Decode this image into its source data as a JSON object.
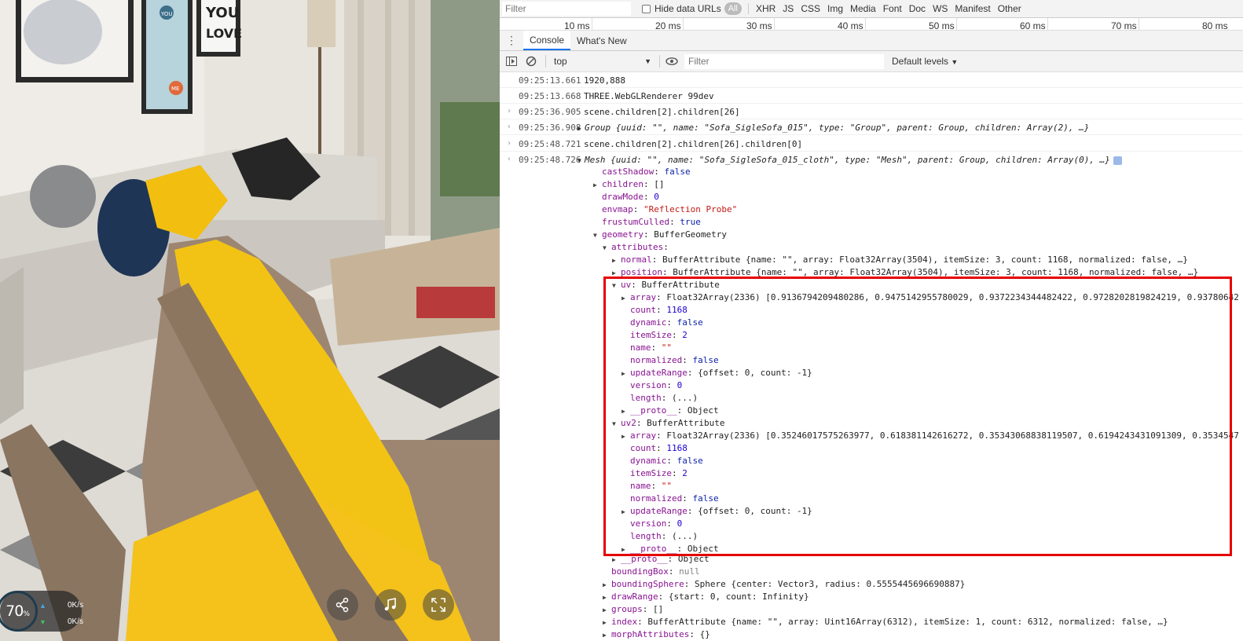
{
  "overlay": {
    "percent": "70",
    "percent_unit": "%",
    "upload_rate": "0K/s",
    "download_rate": "0K/s"
  },
  "scene_art": {
    "poster_you": "YOU",
    "poster_love": "LOVE",
    "fish_tags": [
      "YOU",
      "ME"
    ]
  },
  "network_bar": {
    "filter_placeholder": "Filter",
    "hide_data_urls": "Hide data URLs",
    "all": "All",
    "types": [
      "XHR",
      "JS",
      "CSS",
      "Img",
      "Media",
      "Font",
      "Doc",
      "WS",
      "Manifest",
      "Other"
    ],
    "ticks": [
      "10 ms",
      "20 ms",
      "30 ms",
      "40 ms",
      "50 ms",
      "60 ms",
      "70 ms",
      "80 ms"
    ]
  },
  "drawer": {
    "tabs": [
      "Console",
      "What's New"
    ]
  },
  "console_toolbar": {
    "context": "top",
    "filter_placeholder": "Filter",
    "levels": "Default levels"
  },
  "messages": [
    {
      "ts": "09:25:13.661",
      "text": "1920,888"
    },
    {
      "ts": "09:25:13.668",
      "text": "THREE.WebGLRenderer 99dev"
    },
    {
      "ts": "09:25:36.905",
      "text": "scene.children[2].children[26]"
    },
    {
      "ts": "09:25:36.908",
      "text": "Group {uuid: \"\", name: \"Sofa_SigleSofa_015\", type: \"Group\", parent: Group, children: Array(2), …}"
    },
    {
      "ts": "09:25:48.721",
      "text": "scene.children[2].children[26].children[0]"
    },
    {
      "ts": "09:25:48.726",
      "text": "Mesh {uuid: \"\", name: \"Sofa_SigleSofa_015_cloth\", type: \"Mesh\", parent: Group, children: Array(0), …}"
    }
  ],
  "tree": [
    {
      "key": "castShadow",
      "sep": ": ",
      "val": "false"
    },
    {
      "key": "children",
      "sep": ": ",
      "val": "[]"
    },
    {
      "key": "drawMode",
      "sep": ": ",
      "val": "0"
    },
    {
      "key": "envmap",
      "sep": ": ",
      "val": "\"Reflection Probe\""
    },
    {
      "key": "frustumCulled",
      "sep": ": ",
      "val": "true"
    },
    {
      "key": "geometry",
      "sep": ": ",
      "val": "BufferGeometry"
    },
    {
      "key": "attributes",
      "sep": ":",
      "val": ""
    },
    {
      "key": "normal",
      "sep": ": ",
      "val": "BufferAttribute {name: \"\", array: Float32Array(3504), itemSize: 3, count: 1168, normalized: false, …}"
    },
    {
      "key": "position",
      "sep": ": ",
      "val": "BufferAttribute {name: \"\", array: Float32Array(3504), itemSize: 3, count: 1168, normalized: false, …}"
    },
    {
      "key": "uv",
      "sep": ": ",
      "val": "BufferAttribute"
    },
    {
      "key": "array",
      "sep": ": ",
      "val": "Float32Array(2336) [0.9136794209480286, 0.9475142955780029, 0.9372234344482422, 0.9728202819824219, 0.93780642"
    },
    {
      "key": "count",
      "sep": ": ",
      "val": "1168"
    },
    {
      "key": "dynamic",
      "sep": ": ",
      "val": "false"
    },
    {
      "key": "itemSize",
      "sep": ": ",
      "val": "2"
    },
    {
      "key": "name",
      "sep": ": ",
      "val": "\"\""
    },
    {
      "key": "normalized",
      "sep": ": ",
      "val": "false"
    },
    {
      "key": "updateRange",
      "sep": ": ",
      "val": "{offset: 0, count: -1}"
    },
    {
      "key": "version",
      "sep": ": ",
      "val": "0"
    },
    {
      "key": "length",
      "sep": ": ",
      "val": "(...)"
    },
    {
      "key": "__proto__",
      "sep": ": ",
      "val": "Object"
    },
    {
      "key": "uv2",
      "sep": ": ",
      "val": "BufferAttribute"
    },
    {
      "key": "array",
      "sep": ": ",
      "val": "Float32Array(2336) [0.35246017575263977, 0.618381142616272, 0.35343068838119507, 0.6194243431091309, 0.3534547"
    },
    {
      "key": "count",
      "sep": ": ",
      "val": "1168"
    },
    {
      "key": "dynamic",
      "sep": ": ",
      "val": "false"
    },
    {
      "key": "itemSize",
      "sep": ": ",
      "val": "2"
    },
    {
      "key": "name",
      "sep": ": ",
      "val": "\"\""
    },
    {
      "key": "normalized",
      "sep": ": ",
      "val": "false"
    },
    {
      "key": "updateRange",
      "sep": ": ",
      "val": "{offset: 0, count: -1}"
    },
    {
      "key": "version",
      "sep": ": ",
      "val": "0"
    },
    {
      "key": "length",
      "sep": ": ",
      "val": "(...)"
    },
    {
      "key": "__proto__",
      "sep": ": ",
      "val": "Object"
    },
    {
      "key": "__proto__",
      "sep": ": ",
      "val": "Object"
    },
    {
      "key": "boundingBox",
      "sep": ": ",
      "val": "null"
    },
    {
      "key": "boundingSphere",
      "sep": ": ",
      "val": "Sphere {center: Vector3, radius: 0.5555445696690887}"
    },
    {
      "key": "drawRange",
      "sep": ": ",
      "val": "{start: 0, count: Infinity}"
    },
    {
      "key": "groups",
      "sep": ": ",
      "val": "[]"
    },
    {
      "key": "index",
      "sep": ": ",
      "val": "BufferAttribute {name: \"\", array: Uint16Array(6312), itemSize: 1, count: 6312, normalized: false, …}"
    },
    {
      "key": "morphAttributes",
      "sep": ": ",
      "val": "{}"
    }
  ]
}
